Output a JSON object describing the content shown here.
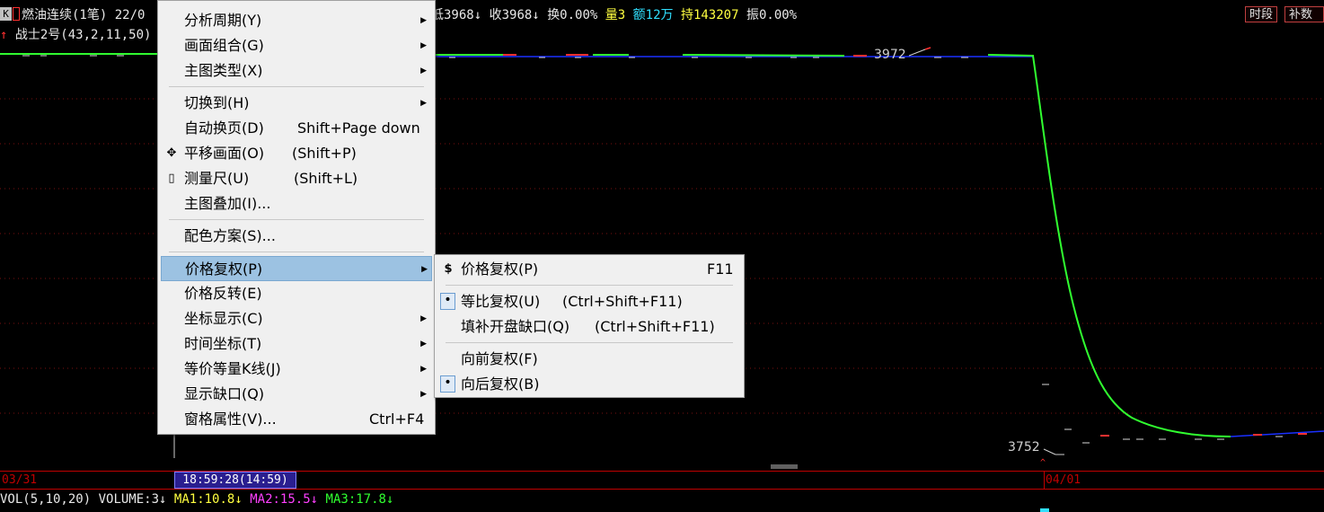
{
  "info": {
    "title": "燃油连续(1笔) 22/0",
    "low": "低3968",
    "close": "收3968",
    "turnover": "换0.00%",
    "volume": "量3",
    "amount": "额12万",
    "hold": "持143207",
    "amplitude": "振0.00%",
    "indicator": "战士2号(43,2,11,50)",
    "k_label": "K"
  },
  "right_buttons": [
    "时段",
    "补数据"
  ],
  "chart_labels": {
    "high": "3972",
    "low": "3752"
  },
  "dates": {
    "left": "03/31",
    "right": "04/01",
    "cursor_time": "18:59:28(14:59)"
  },
  "volume_bar": {
    "prefix": "VOL(5,10,20)",
    "volume": "VOLUME:3",
    "ma1": "MA1:10.8",
    "ma2": "MA2:15.5",
    "ma3": "MA3:17.8"
  },
  "colors": {
    "ma1": "#ffff40",
    "ma2": "#ff40ff",
    "ma3": "#30ff30"
  },
  "menu": {
    "items": [
      {
        "label": "分析周期(Y)",
        "submenu": true
      },
      {
        "label": "画面组合(G)",
        "submenu": true
      },
      {
        "label": "主图类型(X)",
        "submenu": true
      },
      {
        "label": "切换到(H)",
        "submenu": true
      },
      {
        "label": "自动换页(D)",
        "shortcut": "Shift+Page down"
      },
      {
        "label": "平移画面(O)",
        "shortcut": "(Shift+P)",
        "icon": "move-icon"
      },
      {
        "label": "测量尺(U)",
        "shortcut": "(Shift+L)",
        "icon": "ruler-icon"
      },
      {
        "label": "主图叠加(I)..."
      },
      {
        "label": "配色方案(S)..."
      },
      {
        "label": "价格复权(P)",
        "submenu": true,
        "highlighted": true
      },
      {
        "label": "价格反转(E)"
      },
      {
        "label": "坐标显示(C)",
        "submenu": true
      },
      {
        "label": "时间坐标(T)",
        "submenu": true
      },
      {
        "label": "等价等量K线(J)",
        "submenu": true
      },
      {
        "label": "显示缺口(Q)",
        "submenu": true
      },
      {
        "label": "窗格属性(V)...",
        "shortcut": "Ctrl+F4"
      }
    ]
  },
  "submenu": {
    "items": [
      {
        "label": "价格复权(P)",
        "shortcut": "F11",
        "icon": "$"
      },
      {
        "label": "等比复权(U)",
        "shortcut": "(Ctrl+Shift+F11)",
        "checked": true
      },
      {
        "label": "填补开盘缺口(Q)",
        "shortcut": "(Ctrl+Shift+F11)"
      },
      {
        "label": "向前复权(F)"
      },
      {
        "label": "向后复权(B)",
        "checked": true
      }
    ]
  }
}
